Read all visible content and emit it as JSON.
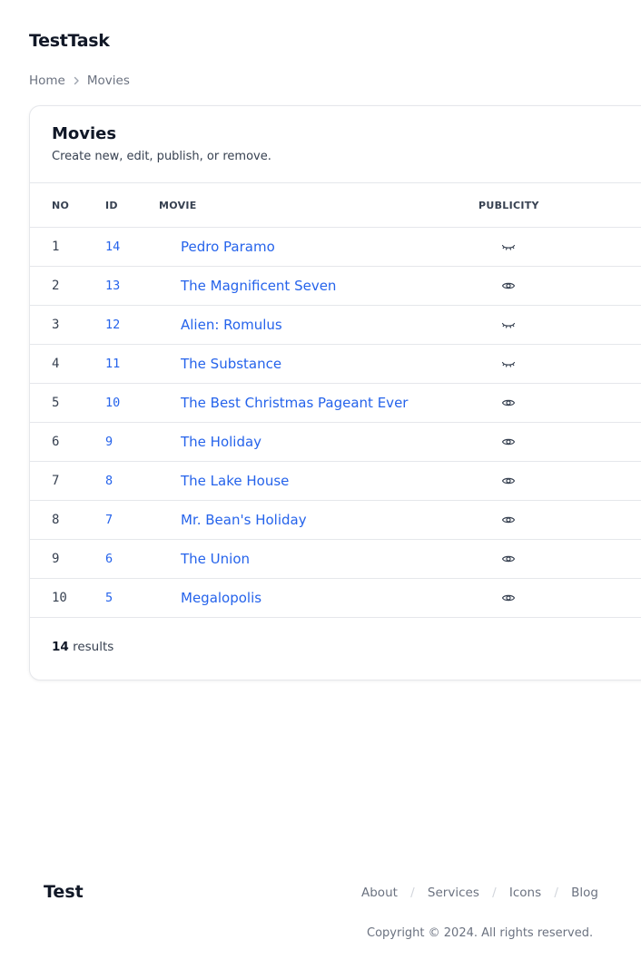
{
  "app": {
    "title": "TestTask"
  },
  "breadcrumb": {
    "items": [
      "Home",
      "Movies"
    ]
  },
  "card": {
    "title": "Movies",
    "subtitle": "Create new, edit, publish, or remove."
  },
  "table": {
    "headers": {
      "no": "NO",
      "id": "ID",
      "movie": "MOVIE",
      "publicity": "PUBLICITY"
    },
    "rows": [
      {
        "no": "1",
        "id": "14",
        "movie": "Pedro Paramo",
        "publicity": "hidden-icon"
      },
      {
        "no": "2",
        "id": "13",
        "movie": "The Magnificent Seven",
        "publicity": "eye-icon"
      },
      {
        "no": "3",
        "id": "12",
        "movie": "Alien: Romulus",
        "publicity": "hidden-icon"
      },
      {
        "no": "4",
        "id": "11",
        "movie": "The Substance",
        "publicity": "hidden-icon"
      },
      {
        "no": "5",
        "id": "10",
        "movie": "The Best Christmas Pageant Ever",
        "publicity": "eye-icon"
      },
      {
        "no": "6",
        "id": "9",
        "movie": "The Holiday",
        "publicity": "eye-icon"
      },
      {
        "no": "7",
        "id": "8",
        "movie": "The Lake House",
        "publicity": "eye-icon"
      },
      {
        "no": "8",
        "id": "7",
        "movie": "Mr. Bean's Holiday",
        "publicity": "eye-icon"
      },
      {
        "no": "9",
        "id": "6",
        "movie": "The Union",
        "publicity": "eye-icon"
      },
      {
        "no": "10",
        "id": "5",
        "movie": "Megalopolis",
        "publicity": "eye-icon"
      }
    ]
  },
  "results": {
    "count": "14",
    "label": "results"
  },
  "footer": {
    "brand": "Test",
    "links": [
      "About",
      "Services",
      "Icons",
      "Blog"
    ],
    "separator": "/",
    "copyright": "Copyright © 2024. All rights reserved."
  }
}
